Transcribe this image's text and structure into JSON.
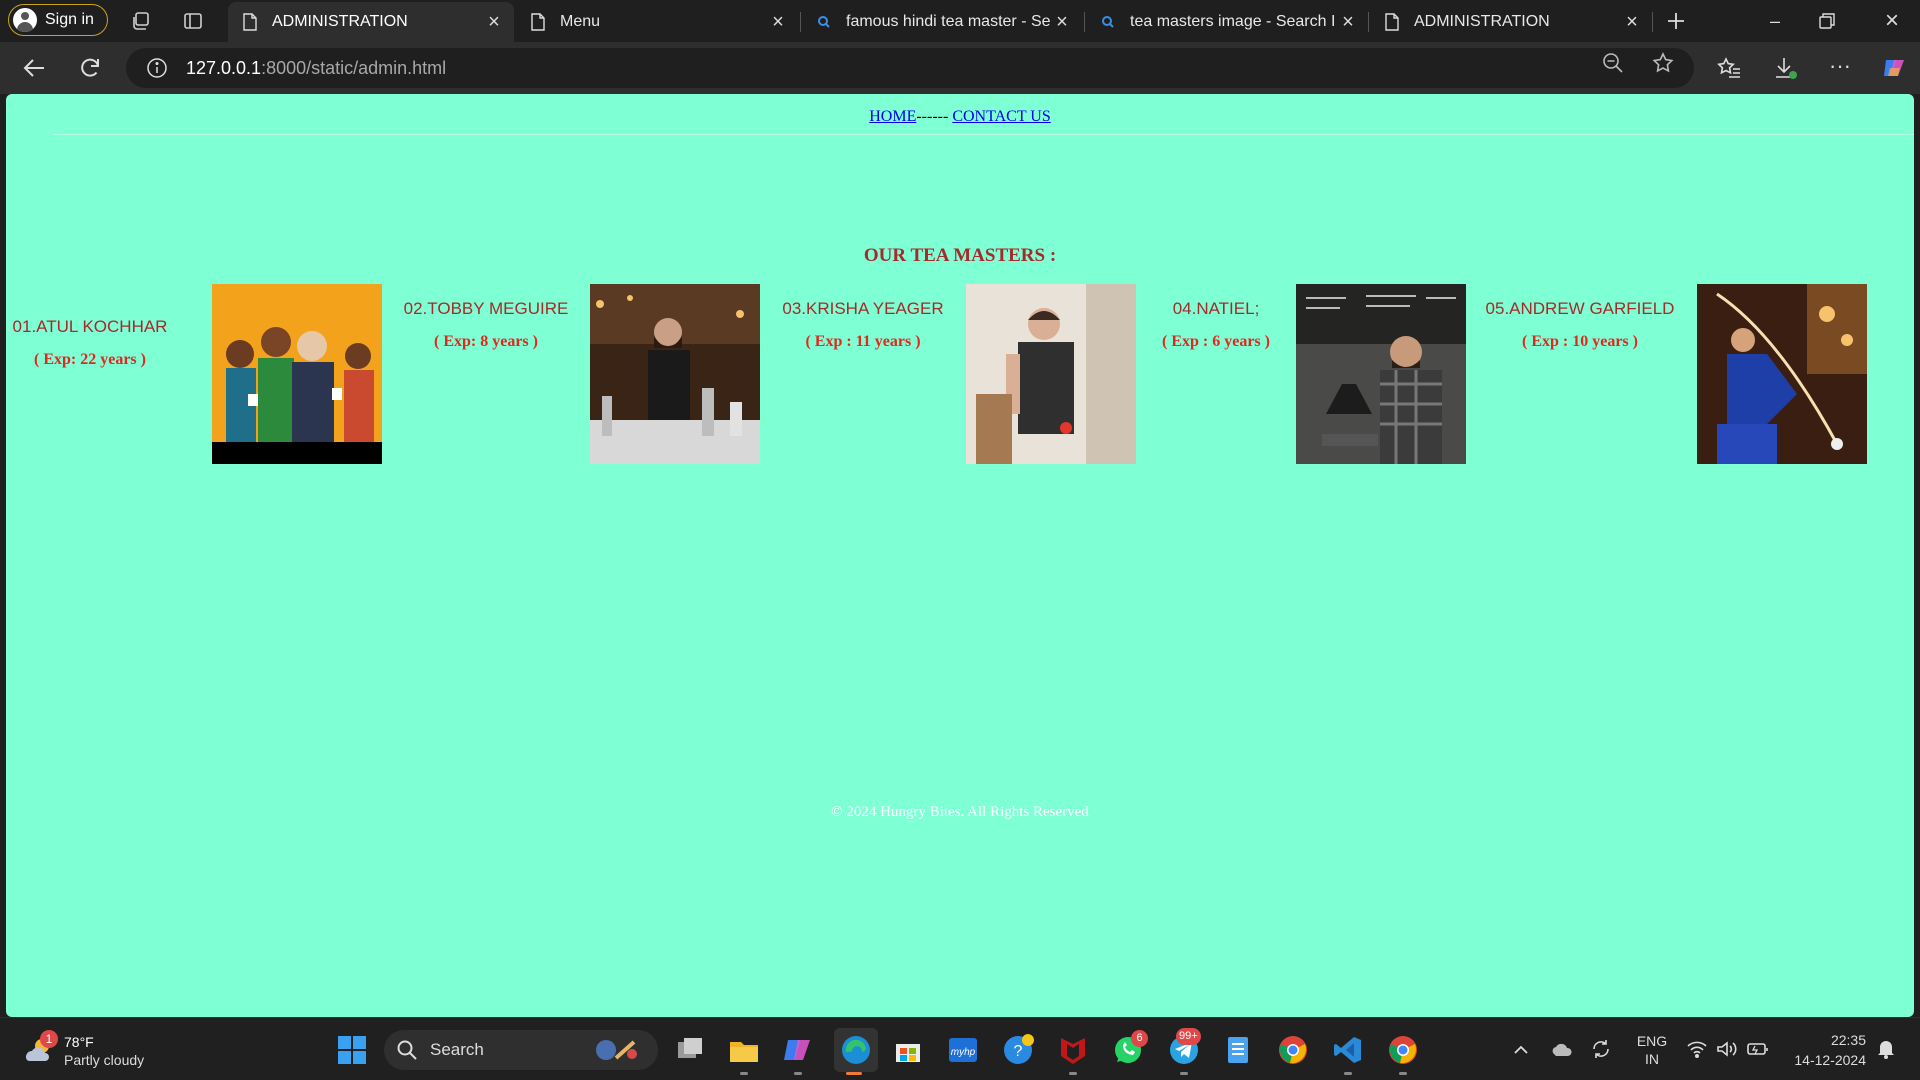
{
  "browser": {
    "signin_label": "Sign in",
    "tabs": [
      {
        "title": "ADMINISTRATION",
        "active": true
      },
      {
        "title": "Menu",
        "active": false
      },
      {
        "title": "famous hindi tea master - Search",
        "active": false
      },
      {
        "title": "tea masters image - Search Images",
        "active": false
      },
      {
        "title": "ADMINISTRATION",
        "active": false
      }
    ],
    "url_host": "127.0.0.1",
    "url_rest": ":8000/static/admin.html"
  },
  "page": {
    "nav": {
      "home": "HOME",
      "separator": "------",
      "contact": "CONTACT US"
    },
    "section_title": "OUR TEA MASTERS :",
    "masters": [
      {
        "name": "01.ATUL KOCHHAR",
        "exp": "( Exp: 22 years )"
      },
      {
        "name": "02.TOBBY MEGUIRE",
        "exp": "( Exp: 8 years )"
      },
      {
        "name": "03.KRISHA YEAGER",
        "exp": "( Exp : 11 years )"
      },
      {
        "name": "04.NATIEL;",
        "exp": "( Exp : 6 years )"
      },
      {
        "name": "05.ANDREW GARFIELD",
        "exp": "( Exp : 10 years )"
      }
    ],
    "footer": "© 2024 Hungry Bites. All Rights Reserved"
  },
  "taskbar": {
    "weather_temp": "78°F",
    "weather_cond": "Partly cloudy",
    "weather_badge": "1",
    "search_label": "Search",
    "whatsapp_badge": "6",
    "telegram_badge": "99+",
    "lang_top": "ENG",
    "lang_bottom": "IN",
    "time": "22:35",
    "date": "14-12-2024"
  },
  "colors": {
    "page_bg": "#7fffd4",
    "heading": "#a52a2a",
    "experience": "#e0281f",
    "link": "#0000ee"
  }
}
